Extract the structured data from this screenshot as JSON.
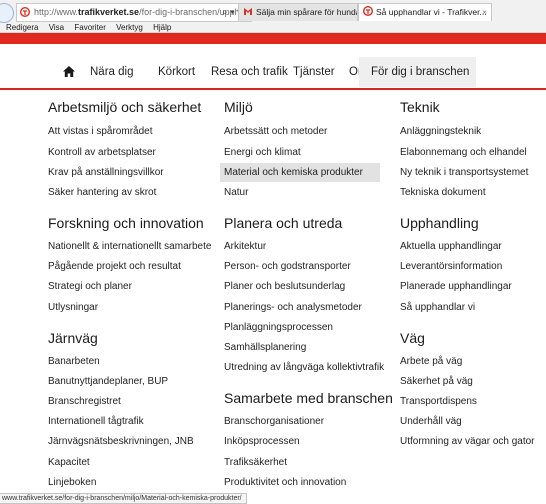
{
  "browser": {
    "url_prefix": "http://www.",
    "url_domain": "trafikverket.se",
    "url_rest": "/for-dig-i-branschen/upphä",
    "url_controls": "⌕ ▾ ⟳",
    "tabs": [
      {
        "label": "Sälja min spårare för hundar o...",
        "icon": "gmail-icon",
        "color": "#d93025"
      },
      {
        "label": "Så upphandlar vi - Trafikver...",
        "icon": "trafikverket-icon",
        "close": "×",
        "color": "#e12a1f"
      }
    ],
    "menu": [
      "Redigera",
      "Visa",
      "Favoriter",
      "Verktyg",
      "Hjälp"
    ],
    "status_url": "www.trafikverket.se/for-dig-i-branschen/miljo/Material-och-kemiska-produkter/"
  },
  "nav": {
    "items": [
      "Nära dig",
      "Körkort",
      "Resa och trafik",
      "Tjänster",
      "Om oss",
      "För dig i branschen"
    ]
  },
  "columns": [
    {
      "sections": [
        {
          "title": "Arbetsmiljö och säkerhet",
          "links": [
            "Att vistas i spårområdet",
            "Kontroll av arbetsplatser",
            "Krav på anställningsvillkor",
            "Säker hantering av skrot"
          ]
        },
        {
          "title": "Forskning och innovation",
          "links": [
            "Nationellt & internationellt samarbete",
            "Pågående projekt och resultat",
            "Strategi och planer",
            "Utlysningar"
          ]
        },
        {
          "title": "Järnväg",
          "links": [
            "Banarbeten",
            "Banutnyttjandeplaner, BUP",
            "Branschregistret",
            "Internationell tågtrafik",
            "Järnvägsnätsbeskrivningen, JNB",
            "Kapacitet",
            "Linjeboken"
          ]
        }
      ]
    },
    {
      "sections": [
        {
          "title": "Miljö",
          "links": [
            "Arbetssätt och metoder",
            "Energi och klimat",
            "Material och kemiska produkter",
            "Natur"
          ]
        },
        {
          "title": "Planera och utreda",
          "links": [
            "Arkitektur",
            "Person- och godstransporter",
            "Planer och beslutsunderlag",
            "Planerings- och analysmetoder",
            "Planläggningsprocessen",
            "Samhällsplanering",
            "Utredning av långväga kollektivtrafik"
          ]
        },
        {
          "title": "Samarbete med branschen",
          "links": [
            "Branschorganisationer",
            "Inköpsprocessen",
            "Trafiksäkerhet",
            "Produktivitet och innovation"
          ]
        }
      ]
    },
    {
      "sections": [
        {
          "title": "Teknik",
          "links": [
            "Anläggningsteknik",
            "Elabonnemang och elhandel",
            "Ny teknik i transportsystemet",
            "Tekniska dokument"
          ]
        },
        {
          "title": "Upphandling",
          "links": [
            "Aktuella upphandlingar",
            "Leverantörsinformation",
            "Planerade upphandlingar",
            "Så upphandlar vi"
          ]
        },
        {
          "title": "Väg",
          "links": [
            "Arbete på väg",
            "Säkerhet på väg",
            "Transportdispens",
            "Underhåll väg",
            "Utformning av vägar och gator"
          ]
        }
      ]
    }
  ],
  "highlighted_link": "Material och kemiska produkter",
  "colors": {
    "brand_red": "#e12a1f",
    "hover_bg": "#e2e2e2",
    "active_tab_bg": "#efefef"
  }
}
